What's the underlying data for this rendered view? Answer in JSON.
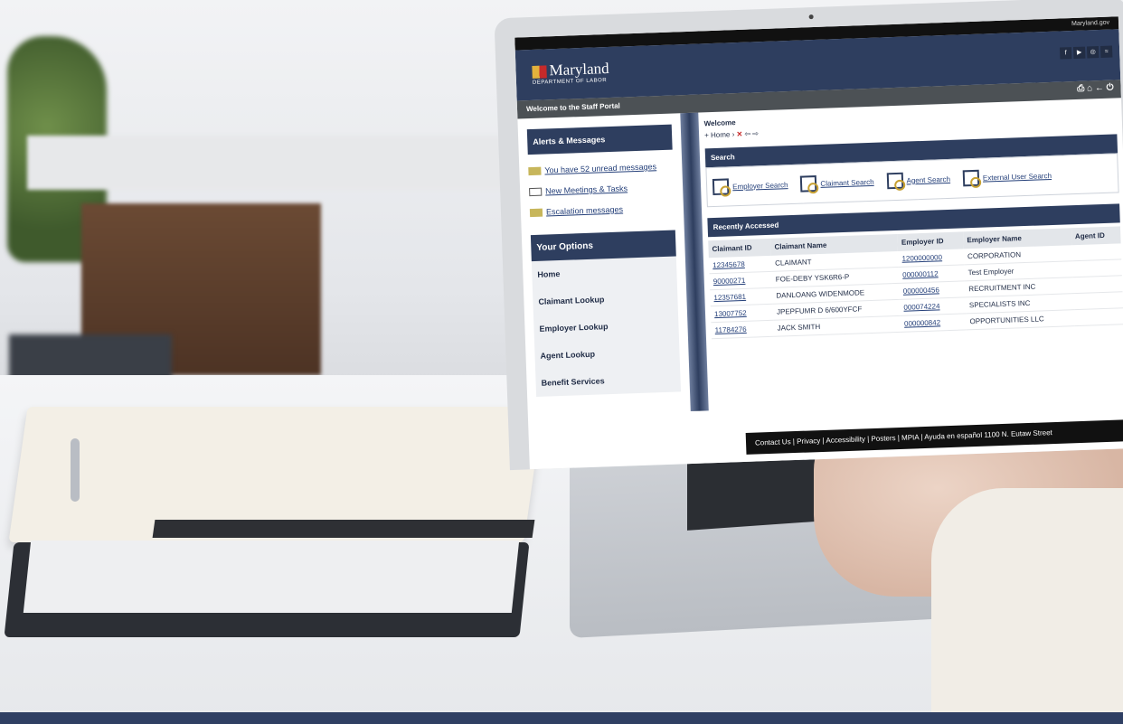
{
  "site": {
    "top_right": "Maryland.gov",
    "brand": "Maryland",
    "brand_sub": "DEPARTMENT OF LABOR"
  },
  "welcome_bar": "Welcome to the Staff Portal",
  "alerts": {
    "title": "Alerts & Messages",
    "items": [
      {
        "icon": "envelope-icon",
        "label": "You have 52 unread messages"
      },
      {
        "icon": "calendar-icon",
        "label": "New Meetings & Tasks"
      },
      {
        "icon": "envelope-icon",
        "label": "Escalation messages"
      }
    ]
  },
  "options": {
    "title": "Your Options",
    "items": [
      "Home",
      "Claimant Lookup",
      "Employer Lookup",
      "Agent Lookup",
      "Benefit Services"
    ]
  },
  "main": {
    "welcome": "Welcome",
    "breadcrumb": "Home",
    "search_title": "Search",
    "search_buttons": [
      "Employer Search",
      "Claimant Search",
      "Agent Search",
      "External User Search"
    ],
    "recent_title": "Recently Accessed",
    "columns": [
      "Claimant ID",
      "Claimant Name",
      "Employer ID",
      "Employer Name",
      "Agent ID"
    ],
    "rows": [
      [
        "12345678",
        "CLAIMANT",
        "1200000000",
        "CORPORATION",
        ""
      ],
      [
        "90000271",
        "FOE-DEBY YSK6R6-P",
        "000000112",
        "Test Employer",
        ""
      ],
      [
        "12357681",
        "DANLOANG WIDENMODE",
        "000000456",
        "RECRUITMENT INC",
        ""
      ],
      [
        "13007752",
        "JPEPFUMR D 6/600YFCF",
        "000074224",
        "SPECIALISTS INC",
        ""
      ],
      [
        "11784276",
        "JACK SMITH",
        "000000842",
        "OPPORTUNITIES LLC",
        ""
      ]
    ]
  },
  "footer": "Contact Us | Privacy | Accessibility | Posters | MPIA | Ayuda en español     1100 N. Eutaw Street"
}
